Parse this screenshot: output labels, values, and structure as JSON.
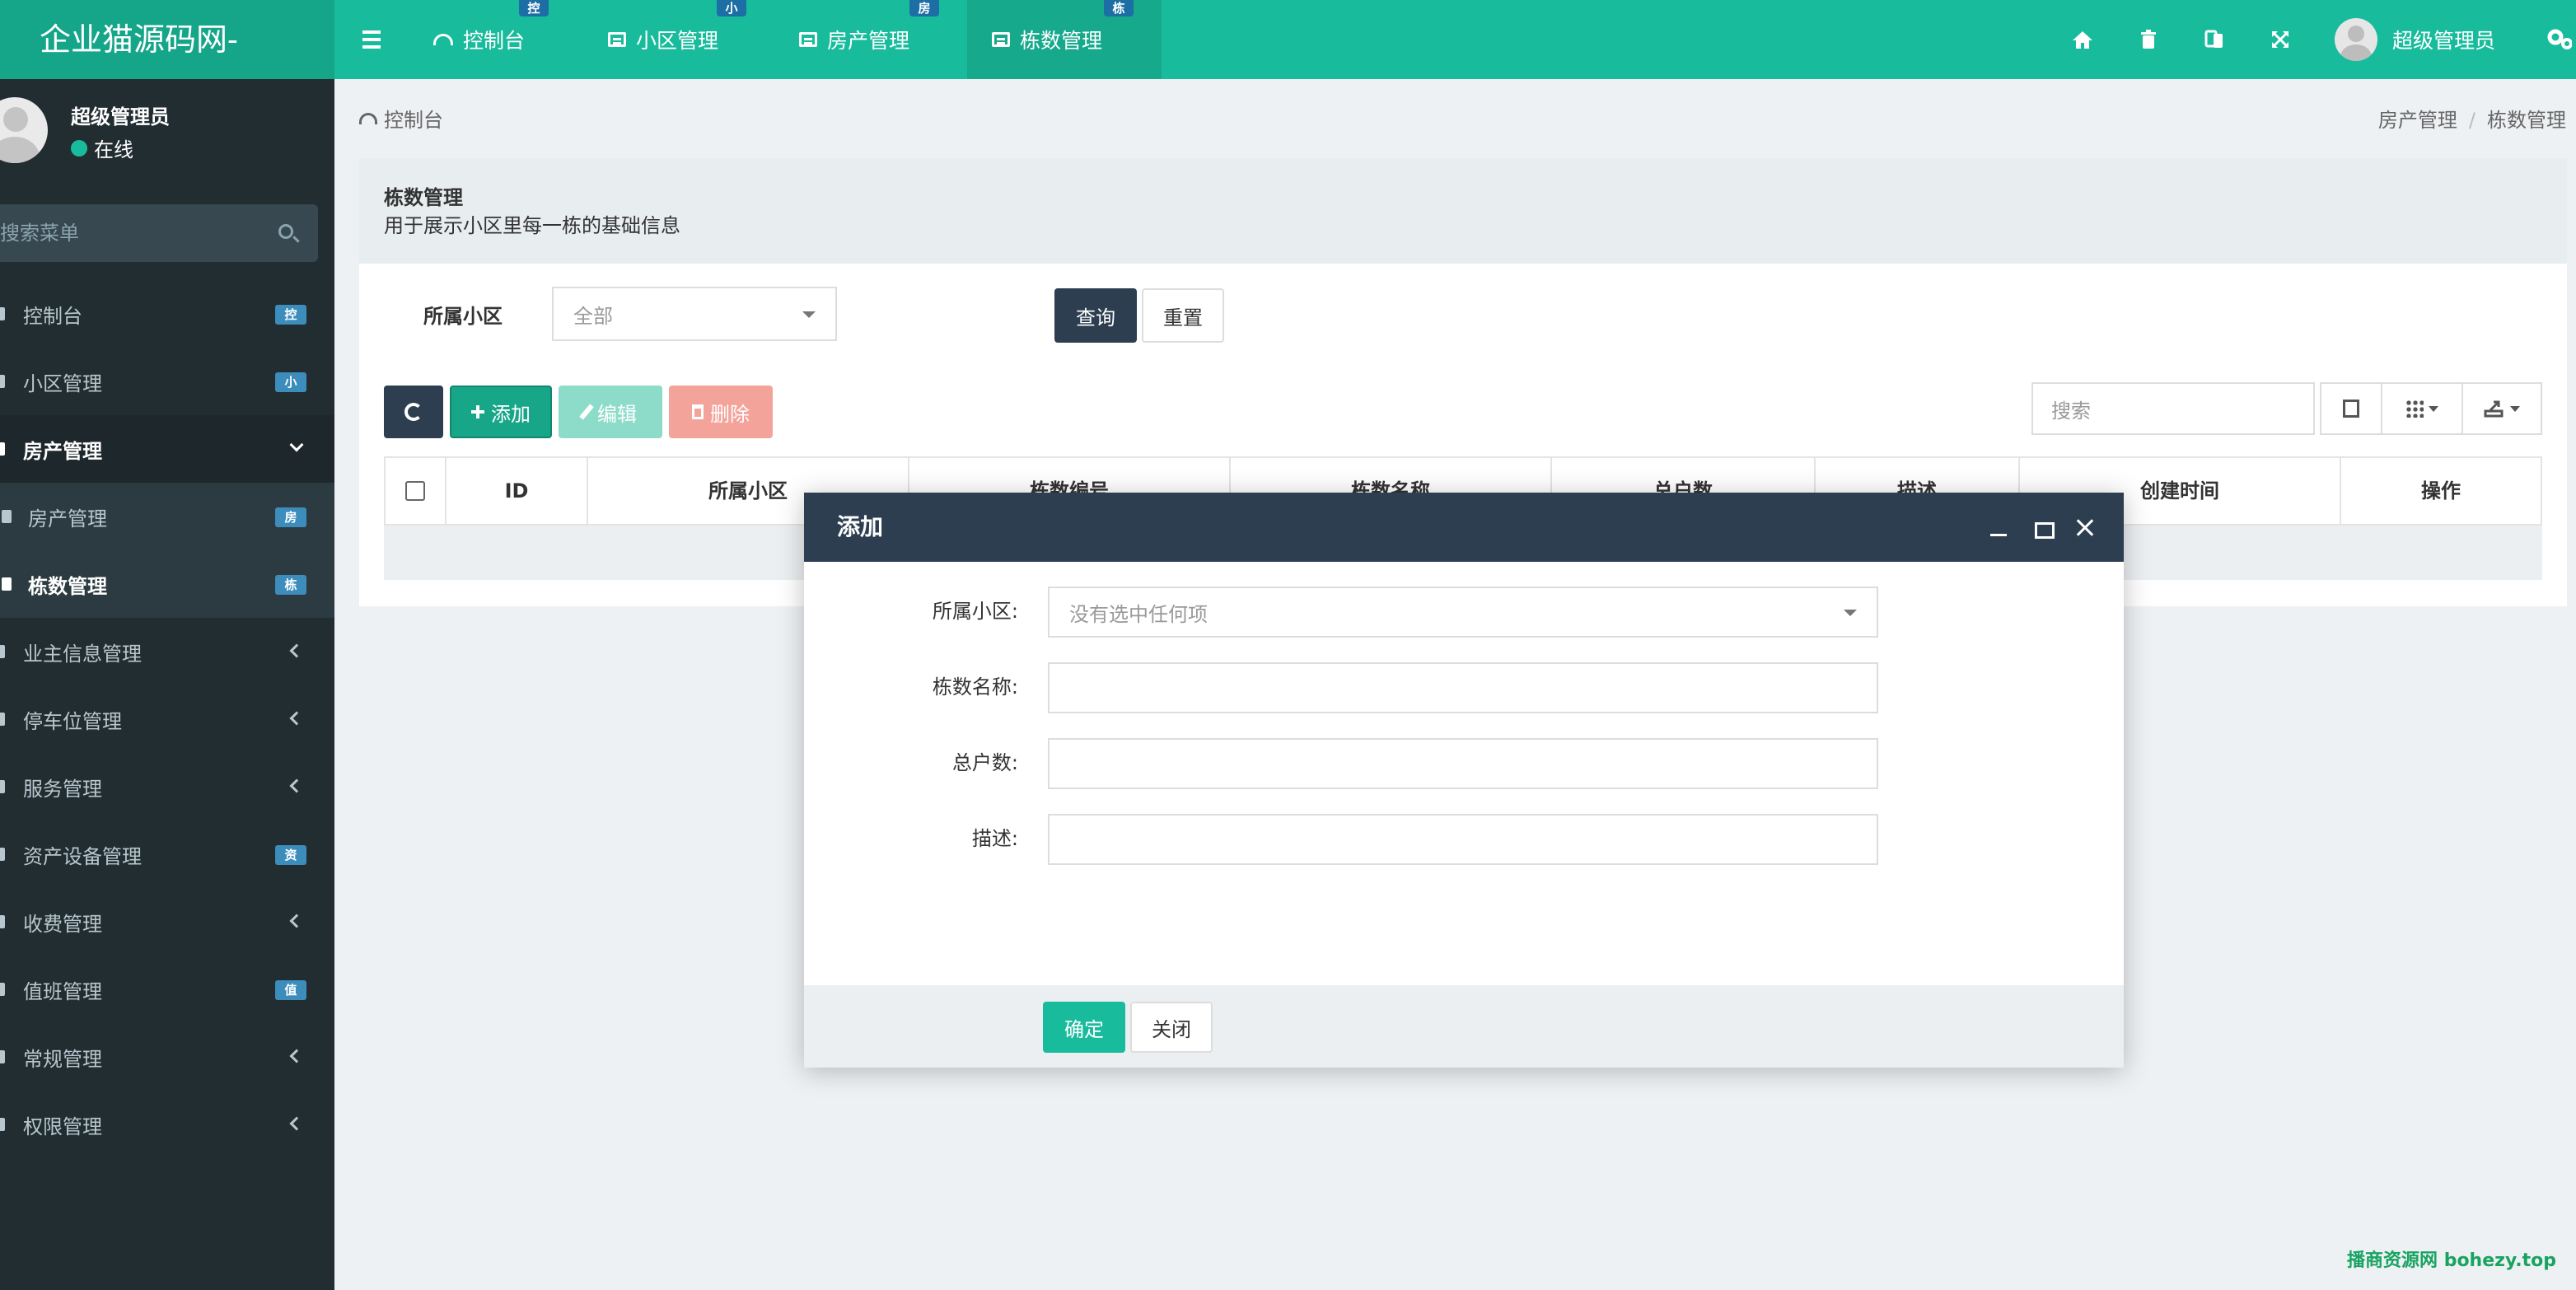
{
  "app": {
    "logo": "企业猫源码网-"
  },
  "topnav": {
    "tabs": [
      {
        "label": "控制台",
        "badge": "控"
      },
      {
        "label": "小区管理",
        "badge": "小"
      },
      {
        "label": "房产管理",
        "badge": "房"
      },
      {
        "label": "栋数管理",
        "badge": "栋",
        "active": true
      }
    ],
    "user_name": "超级管理员",
    "icons": [
      "home-icon",
      "trash-icon",
      "translate-icon",
      "fullscreen-icon",
      "settings-icon"
    ]
  },
  "sidebar": {
    "user_name": "超级管理员",
    "status": "在线",
    "search_placeholder": "搜索菜单",
    "items": [
      {
        "label": "控制台",
        "badge": "控"
      },
      {
        "label": "小区管理",
        "badge": "小"
      },
      {
        "label": "房产管理",
        "expanded": true
      },
      {
        "label": "房产管理",
        "badge": "房",
        "sub": true
      },
      {
        "label": "栋数管理",
        "badge": "栋",
        "sub": true,
        "current": true
      },
      {
        "label": "业主信息管理"
      },
      {
        "label": "停车位管理"
      },
      {
        "label": "服务管理"
      },
      {
        "label": "资产设备管理",
        "badge": "资"
      },
      {
        "label": "收费管理"
      },
      {
        "label": "值班管理",
        "badge": "值"
      },
      {
        "label": "常规管理"
      },
      {
        "label": "权限管理"
      }
    ]
  },
  "breadcrumb": {
    "left": "控制台",
    "right": [
      "房产管理",
      "栋数管理"
    ]
  },
  "panel": {
    "title": "栋数管理",
    "description": "用于展示小区里每一栋的基础信息"
  },
  "filter": {
    "label": "所属小区",
    "value": "全部",
    "query_btn": "查询",
    "reset_btn": "重置"
  },
  "toolbar": {
    "add": "添加",
    "edit": "编辑",
    "delete": "删除",
    "search_placeholder": "搜索"
  },
  "table": {
    "columns": [
      "ID",
      "所属小区",
      "栋数编号",
      "栋数名称",
      "总户数",
      "描述",
      "创建时间",
      "操作"
    ]
  },
  "modal": {
    "title": "添加",
    "fields": [
      {
        "label": "所属小区:",
        "placeholder": "没有选中任何项",
        "type": "select"
      },
      {
        "label": "栋数名称:",
        "value": ""
      },
      {
        "label": "总户数:",
        "value": ""
      },
      {
        "label": "描述:",
        "value": ""
      }
    ],
    "confirm": "确定",
    "close": "关闭"
  },
  "watermark": "播商资源网 bohezy.top",
  "colors": {
    "primary": "#18bc9c",
    "sidebar": "#222d32",
    "dark": "#2c3e50",
    "badge": "#3c8dbc"
  }
}
